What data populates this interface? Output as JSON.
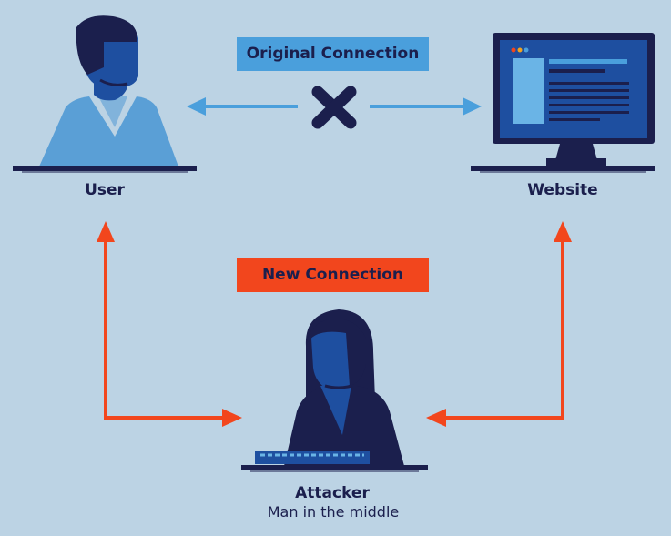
{
  "labels": {
    "original_connection": "Original Connection",
    "new_connection": "New Connection",
    "user": "User",
    "website": "Website",
    "attacker": "Attacker",
    "attacker_subtitle": "Man in the middle"
  },
  "colors": {
    "background": "#bcd3e4",
    "navy": "#1b1f4d",
    "blue": "#1e4fa0",
    "light_blue": "#4a9fdc",
    "orange": "#f2461d"
  },
  "icons": [
    "user-figure-icon",
    "website-monitor-icon",
    "attacker-figure-icon",
    "blocked-x-icon"
  ]
}
